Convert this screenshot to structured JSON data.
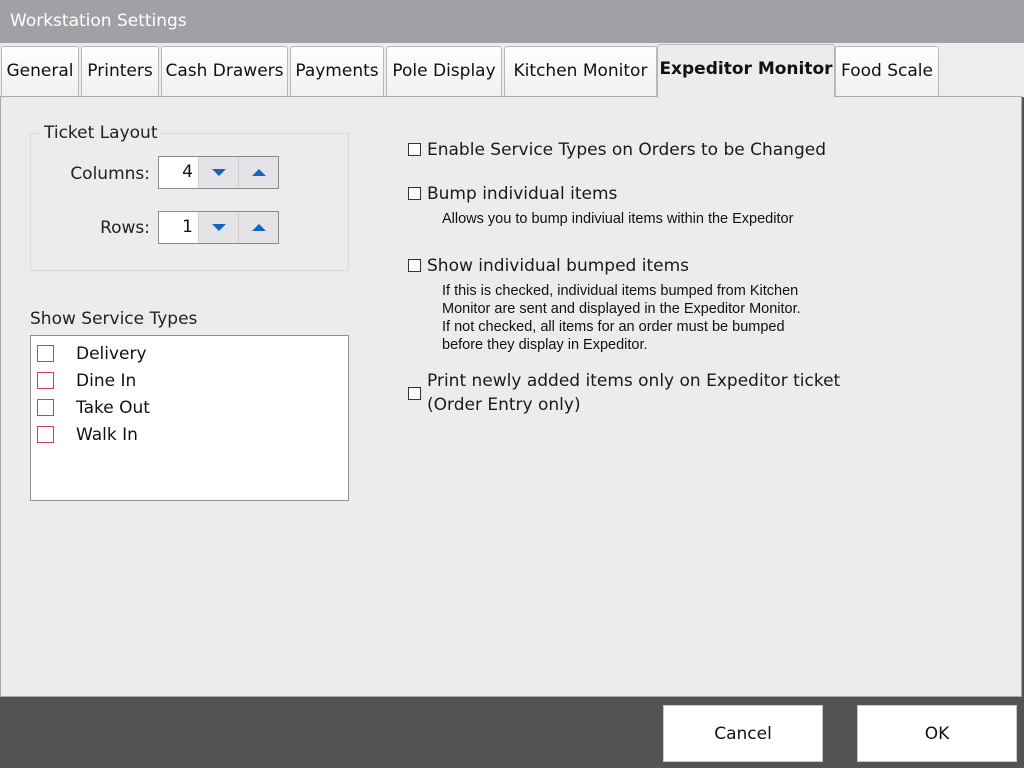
{
  "window": {
    "title": "Workstation Settings"
  },
  "tabs": [
    {
      "label": "General",
      "active": false
    },
    {
      "label": "Printers",
      "active": false
    },
    {
      "label": "Cash Drawers",
      "active": false
    },
    {
      "label": "Payments",
      "active": false
    },
    {
      "label": "Pole Display",
      "active": false
    },
    {
      "label": "Kitchen Monitor",
      "active": false
    },
    {
      "label": "Expeditor Monitor",
      "active": true
    },
    {
      "label": "Food Scale",
      "active": false
    }
  ],
  "ticket_layout": {
    "title": "Ticket Layout",
    "columns": {
      "label": "Columns:",
      "value": "4"
    },
    "rows": {
      "label": "Rows:",
      "value": "1"
    }
  },
  "service_types": {
    "label": "Show Service Types",
    "items": [
      {
        "label": "Delivery",
        "checked": false
      },
      {
        "label": "Dine In",
        "checked": false
      },
      {
        "label": "Take Out",
        "checked": false
      },
      {
        "label": "Walk In",
        "checked": false
      }
    ]
  },
  "options": [
    {
      "label": "Enable Service Types on Orders to be Changed",
      "checked": false
    },
    {
      "label": "Bump individual items",
      "checked": false,
      "description": "Allows you to bump indiviual items within the Expeditor"
    },
    {
      "label": "Show individual bumped items",
      "checked": false,
      "description_lines": [
        "If this is checked, individual items bumped from Kitchen",
        "Monitor are sent and displayed in the Expeditor Monitor.",
        "If not checked, all items for an order must be bumped",
        "before they display in Expeditor."
      ]
    },
    {
      "label_lines": [
        "Print newly added items only on Expeditor ticket",
        "(Order Entry only)"
      ],
      "checked": false
    }
  ],
  "footer": {
    "cancel_label": "Cancel",
    "ok_label": "OK"
  }
}
